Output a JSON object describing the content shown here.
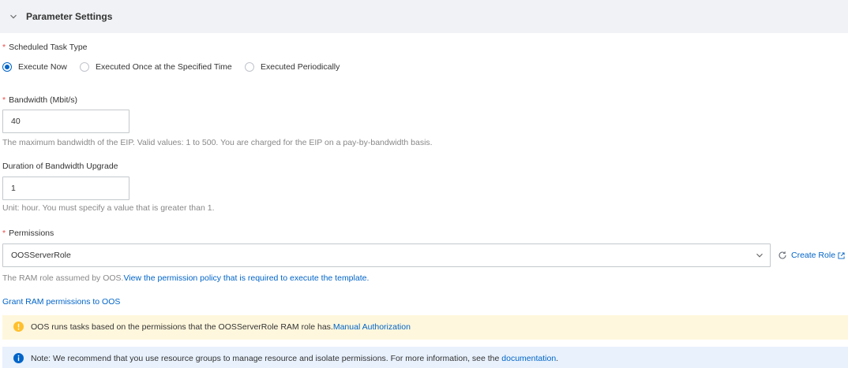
{
  "section": {
    "title": "Parameter Settings",
    "toggle_icon": "chevron-down-icon"
  },
  "fields": {
    "scheduled_task_type": {
      "required_mark": "*",
      "label": "Scheduled Task Type",
      "options": [
        {
          "label": "Execute Now",
          "selected": true
        },
        {
          "label": "Executed Once at the Specified Time",
          "selected": false
        },
        {
          "label": "Executed Periodically",
          "selected": false
        }
      ]
    },
    "bandwidth": {
      "required_mark": "*",
      "label": "Bandwidth (Mbit/s)",
      "value": "40",
      "help": "The maximum bandwidth of the EIP. Valid values: 1 to 500. You are charged for the EIP on a pay-by-bandwidth basis."
    },
    "duration": {
      "label": "Duration of Bandwidth Upgrade",
      "value": "1",
      "help": "Unit: hour. You must specify a value that is greater than 1."
    },
    "permissions": {
      "required_mark": "*",
      "label": "Permissions",
      "selected_value": "OOSServerRole",
      "dropdown_icon": "chevron-down-icon",
      "refresh_icon": "refresh-icon",
      "create_role_label": "Create Role",
      "create_role_icon": "external-link-icon",
      "help_text": "The RAM role assumed by OOS.",
      "help_link": "View the permission policy that is required to execute the template."
    }
  },
  "grant_permissions_link": "Grant RAM permissions to OOS",
  "alerts": {
    "warning": {
      "icon": "warning-icon",
      "text": "OOS runs tasks based on the permissions that the OOSServerRole RAM role has.",
      "link": "Manual Authorization"
    },
    "info": {
      "icon": "info-icon",
      "text": "Note: We recommend that you use resource groups to manage resource and isolate permissions. For more information, see the",
      "link": "documentation",
      "suffix": "."
    }
  },
  "colors": {
    "accent": "#0064c8",
    "required": "#f04a45",
    "warning_icon": "#ffc02e",
    "warning_bg": "#fff7dd",
    "info_icon": "#0064c8",
    "info_bg": "#e8f1fc",
    "header_bg": "#f0f2f5"
  }
}
